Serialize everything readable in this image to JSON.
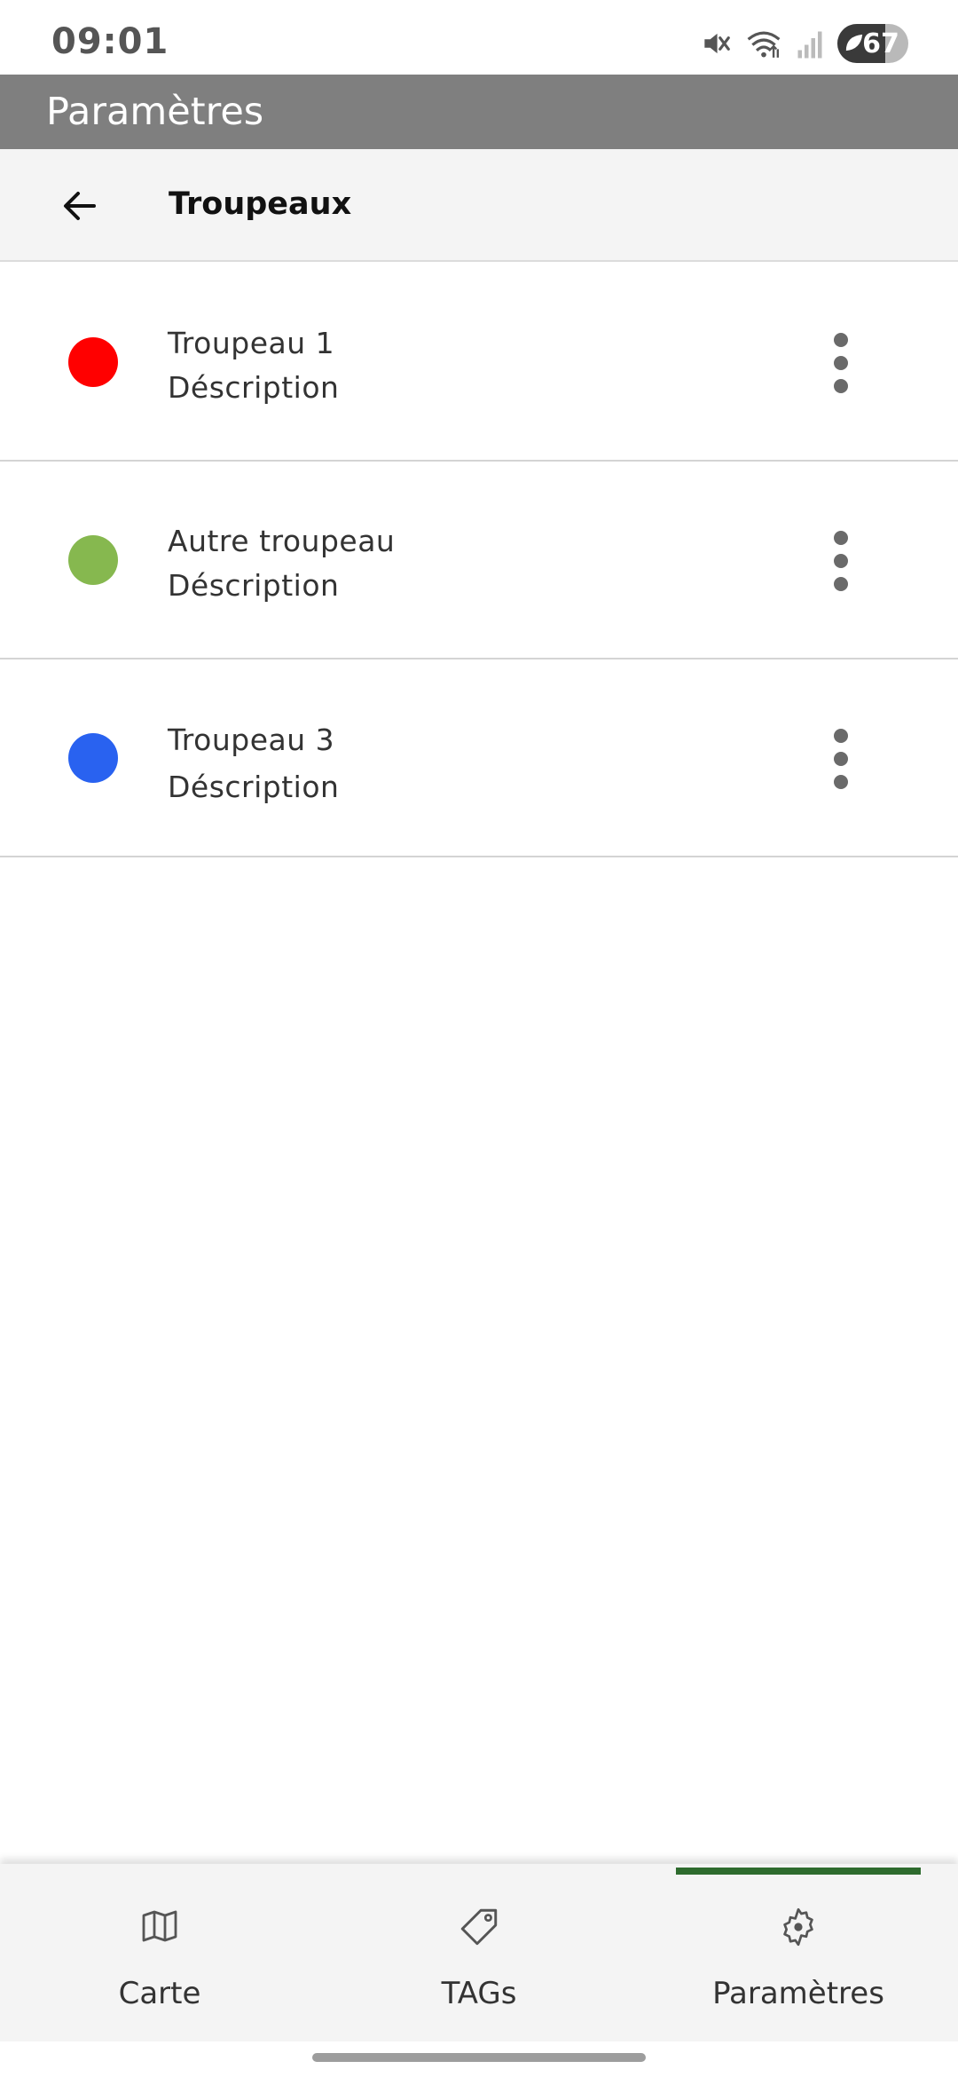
{
  "status_bar": {
    "time": "09:01",
    "battery_level": "67",
    "icons": [
      "mute-icon",
      "wifi-icon",
      "signal-icon",
      "battery-icon"
    ]
  },
  "app_bar": {
    "title": "Paramètres"
  },
  "sub_header": {
    "back_icon": "arrow-left-icon",
    "title": "Troupeaux"
  },
  "herds": [
    {
      "name": "Troupeau 1",
      "description": "Déscription",
      "color": "#ff0000"
    },
    {
      "name": "Autre troupeau",
      "description": "Déscription",
      "color": "#86b84f"
    },
    {
      "name": "Troupeau 3",
      "description": "Déscription",
      "color": "#2962f0"
    }
  ],
  "bottom_nav": {
    "items": [
      {
        "label": "Carte",
        "icon": "map-icon"
      },
      {
        "label": "TAGs",
        "icon": "tag-icon"
      },
      {
        "label": "Paramètres",
        "icon": "gear-icon"
      }
    ],
    "active_index": 2,
    "accent_color": "#2e6b2e"
  }
}
